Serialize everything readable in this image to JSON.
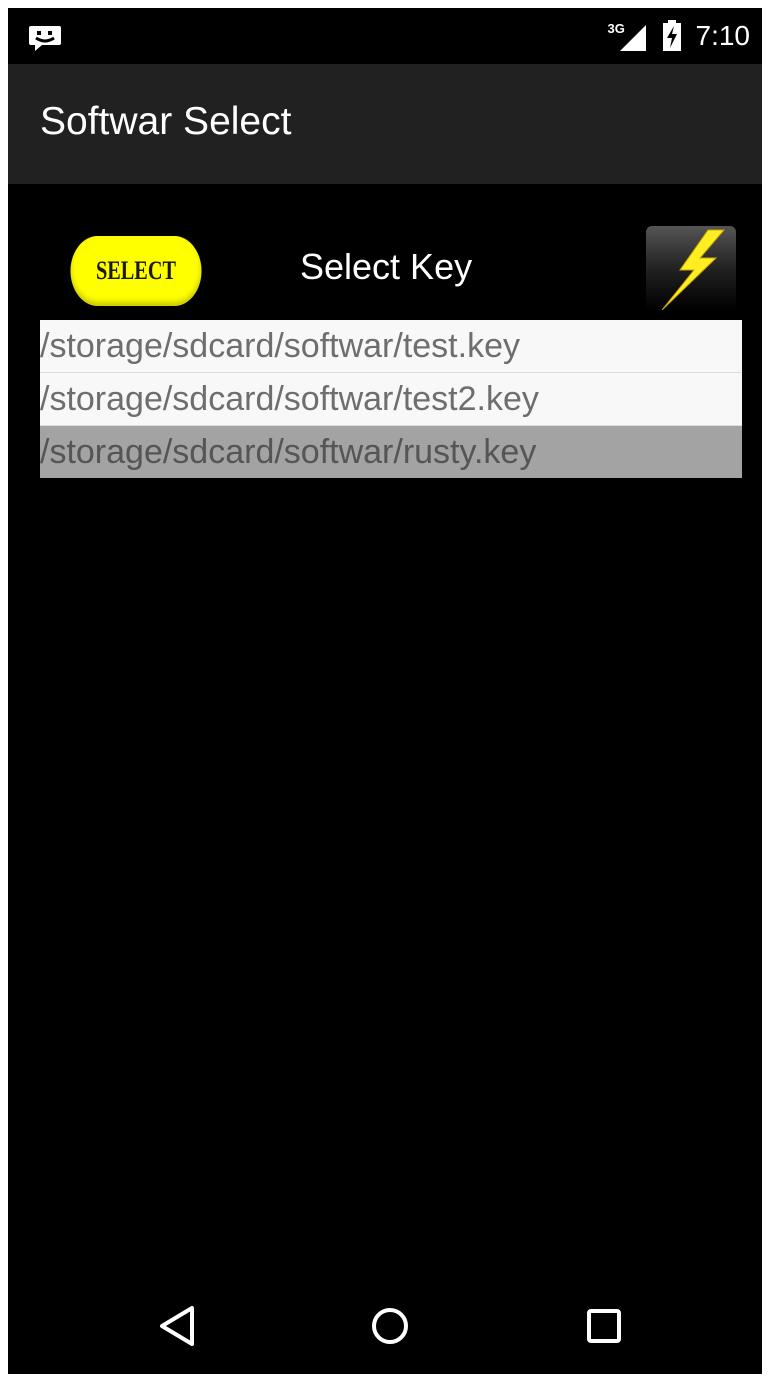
{
  "status_bar": {
    "time": "7:10",
    "network": "3G",
    "notification_icon": "chat-notification-icon",
    "signal_icon": "cell-signal-icon",
    "battery_icon": "battery-charging-icon"
  },
  "action_bar": {
    "title": "Softwar Select"
  },
  "main": {
    "select_button_label": "SELECT",
    "select_key_label": "Select Key",
    "flash_icon": "lightning-bolt-icon",
    "keys": [
      {
        "path": "/storage/sdcard/softwar/test.key",
        "selected": false
      },
      {
        "path": "/storage/sdcard/softwar/test2.key",
        "selected": false
      },
      {
        "path": "/storage/sdcard/softwar/rusty.key",
        "selected": true
      }
    ]
  },
  "nav_bar": {
    "back_icon": "back-triangle-icon",
    "home_icon": "home-circle-icon",
    "recents_icon": "recents-square-icon"
  },
  "colors": {
    "background": "#000000",
    "action_bar": "#212121",
    "select_button": "#ffff00",
    "list_item": "#f8f8f8",
    "list_item_selected": "#a3a3a3",
    "lightning": "#ffee22"
  }
}
